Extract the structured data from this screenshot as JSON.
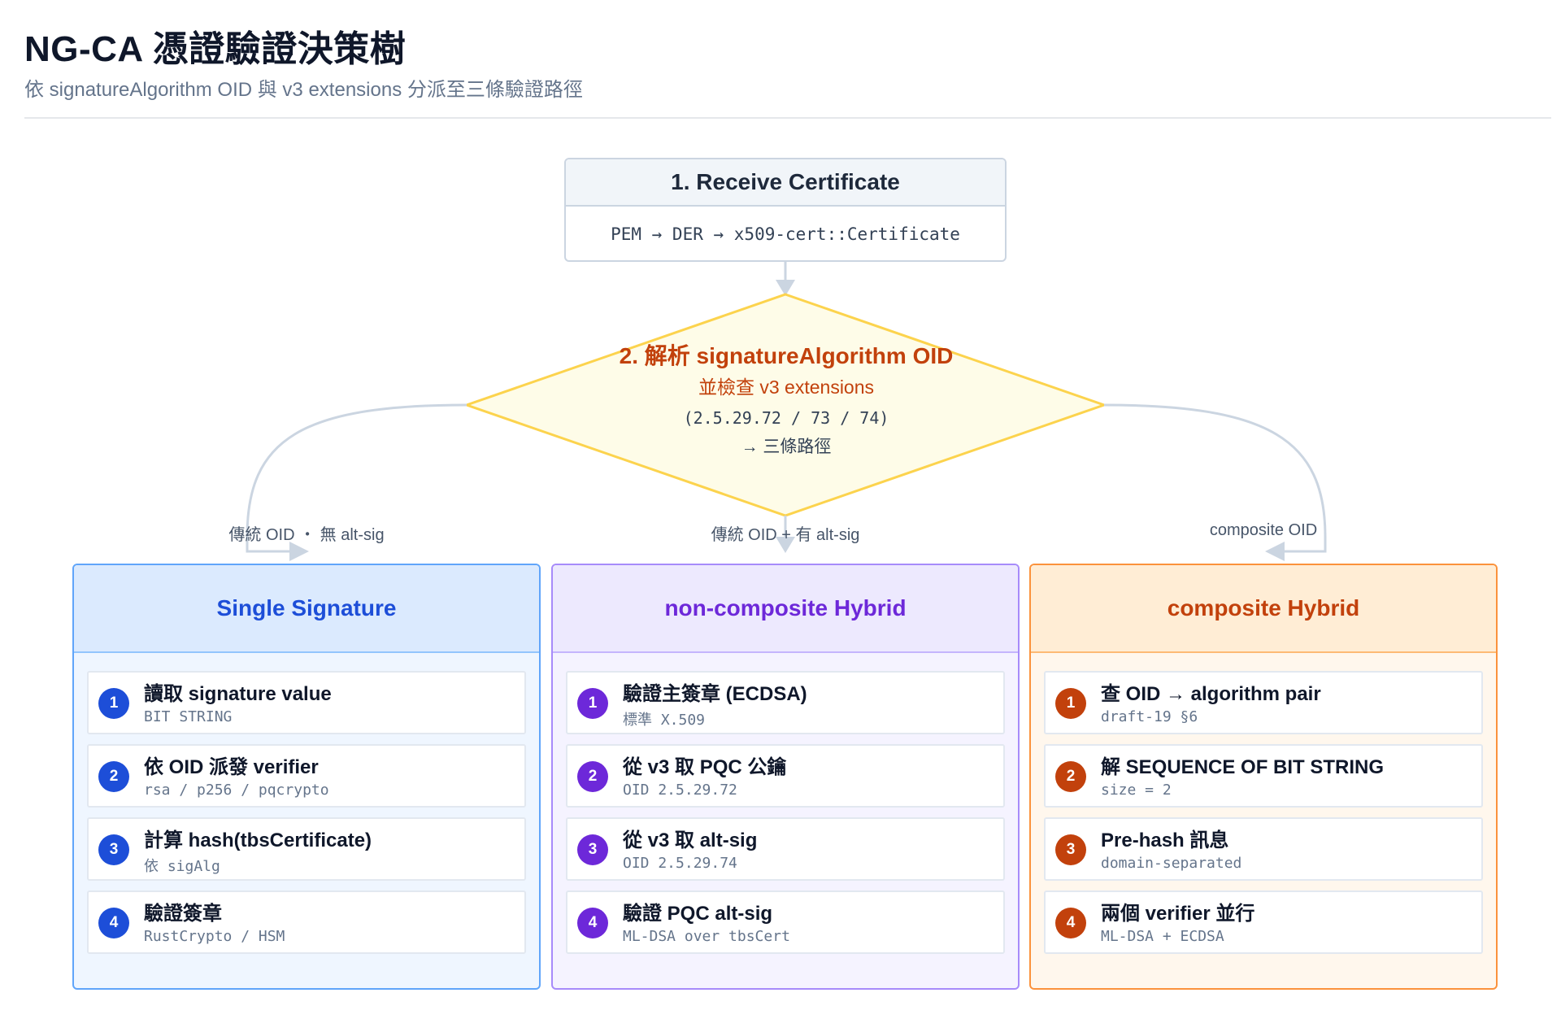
{
  "header": {
    "title": "NG-CA 憑證驗證決策樹",
    "subtitle": "依 signatureAlgorithm OID 與 v3 extensions 分派至三條驗證路徑"
  },
  "start": {
    "title": "1. Receive Certificate",
    "body": "PEM → DER → x509-cert::Certificate"
  },
  "decision": {
    "title": "2. 解析 signatureAlgorithm OID",
    "subtitle": "並檢查 v3 extensions",
    "code": "(2.5.29.72 / 73 / 74)",
    "note": "→ 三條路徑"
  },
  "branches": [
    {
      "label": "傳統 OID ・ 無 alt-sig",
      "title": "Single Signature",
      "color": "#1d4ed8",
      "steps": [
        {
          "num": "1",
          "title": "讀取 signature value",
          "sub": "BIT STRING"
        },
        {
          "num": "2",
          "title": "依 OID 派發 verifier",
          "sub": "rsa / p256 / pqcrypto"
        },
        {
          "num": "3",
          "title": "計算 hash(tbsCertificate)",
          "sub": "依 sigAlg"
        },
        {
          "num": "4",
          "title": "驗證簽章",
          "sub": "RustCrypto / HSM"
        }
      ]
    },
    {
      "label": "傳統 OID + 有 alt-sig",
      "title": "non-composite Hybrid",
      "color": "#6d28d9",
      "steps": [
        {
          "num": "1",
          "title": "驗證主簽章 (ECDSA)",
          "sub": "標準 X.509"
        },
        {
          "num": "2",
          "title": "從 v3 取 PQC 公鑰",
          "sub": "OID 2.5.29.72"
        },
        {
          "num": "3",
          "title": "從 v3 取 alt-sig",
          "sub": "OID 2.5.29.74"
        },
        {
          "num": "4",
          "title": "驗證 PQC alt-sig",
          "sub": "ML-DSA over tbsCert"
        }
      ]
    },
    {
      "label": "composite OID",
      "title": "composite Hybrid",
      "color": "#c2410c",
      "steps": [
        {
          "num": "1",
          "title": "查 OID → algorithm pair",
          "sub": "draft-19 §6"
        },
        {
          "num": "2",
          "title": "解 SEQUENCE OF BIT STRING",
          "sub": "size = 2"
        },
        {
          "num": "3",
          "title": "Pre-hash 訊息",
          "sub": "domain-separated"
        },
        {
          "num": "4",
          "title": "兩個 verifier 並行",
          "sub": "ML-DSA + ECDSA"
        }
      ]
    }
  ]
}
